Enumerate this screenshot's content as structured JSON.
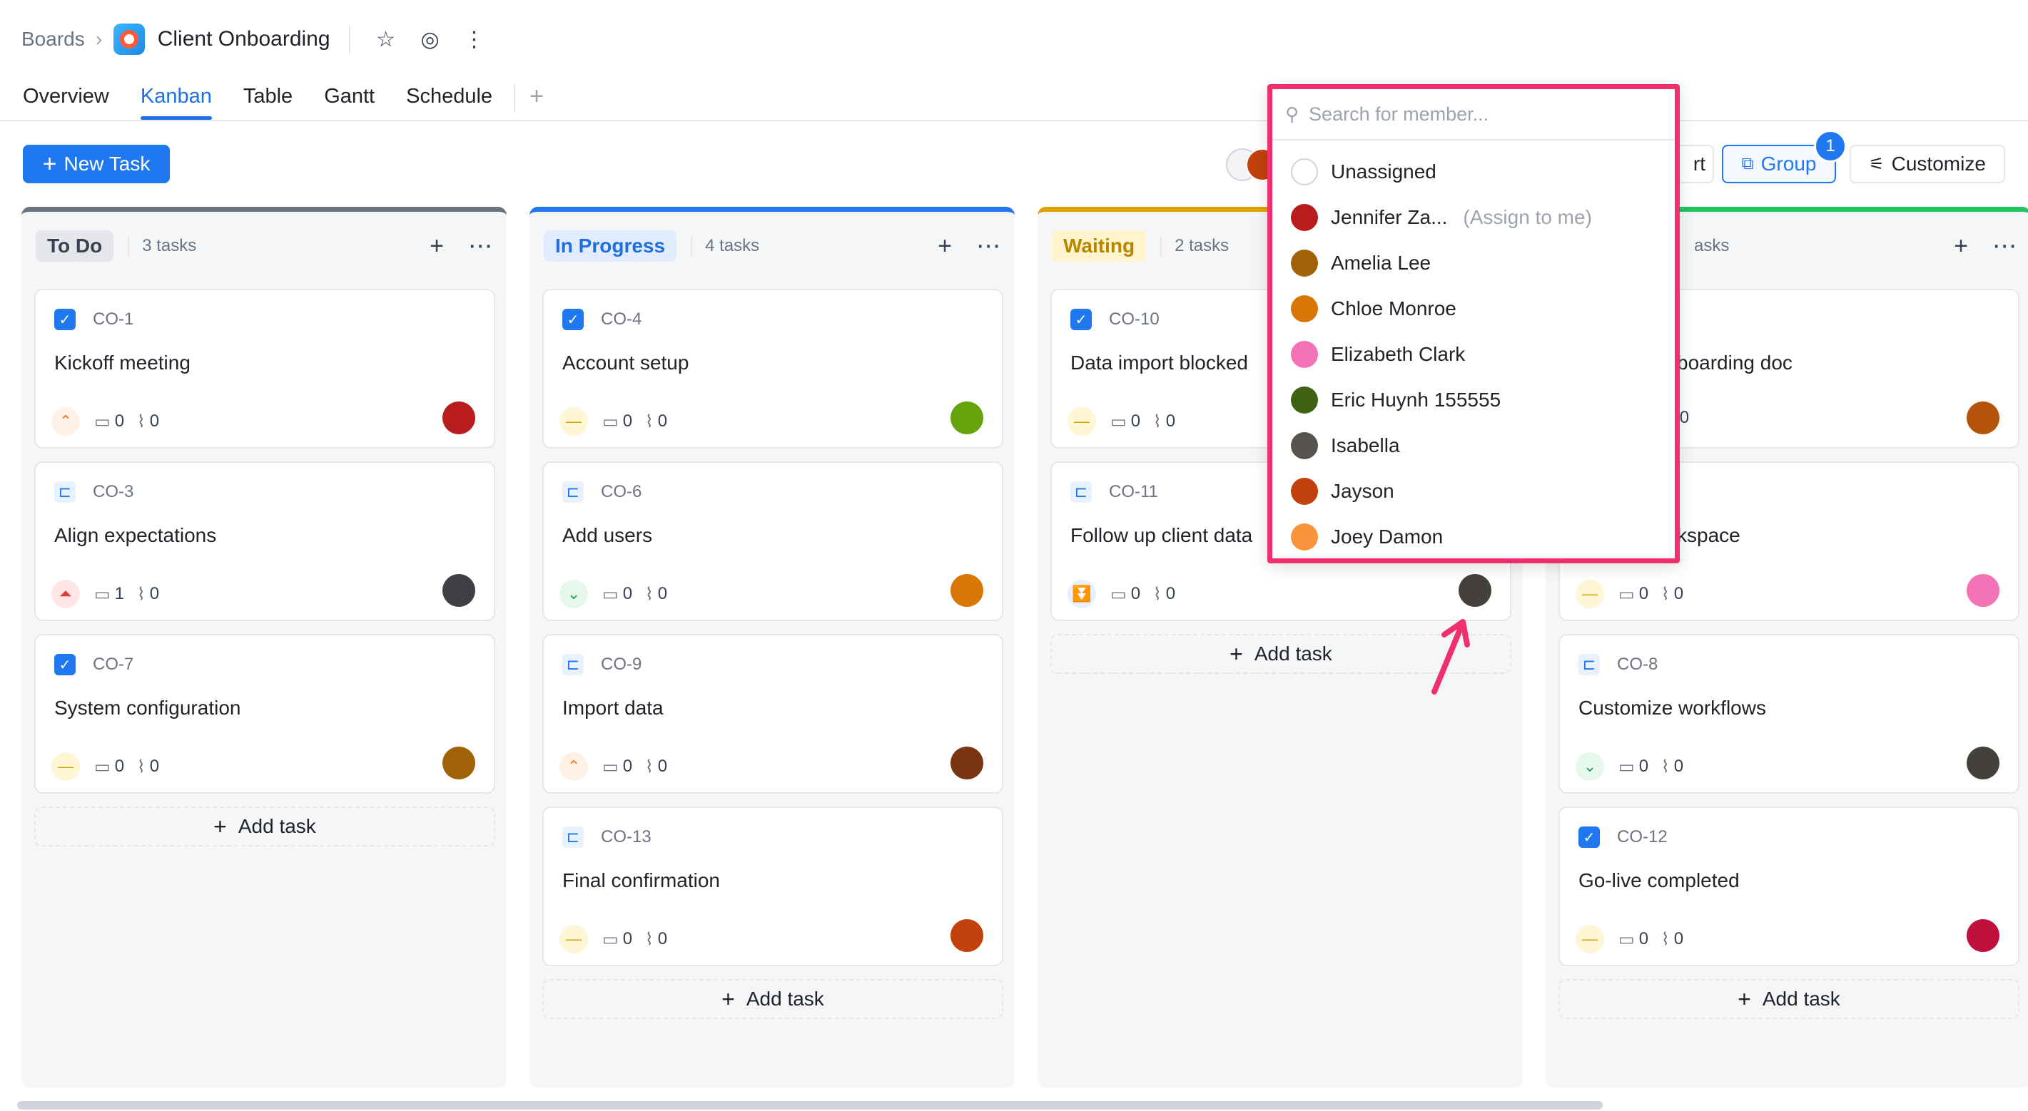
{
  "breadcrumb": {
    "root": "Boards",
    "separator": "›",
    "board": "Client Onboarding"
  },
  "tabs": [
    {
      "label": "Overview",
      "active": false
    },
    {
      "label": "Kanban",
      "active": true
    },
    {
      "label": "Table",
      "active": false
    },
    {
      "label": "Gantt",
      "active": false
    },
    {
      "label": "Schedule",
      "active": false
    }
  ],
  "toolbar": {
    "new_task": "New Task",
    "sort_partial": "rt",
    "group": "Group",
    "group_badge": "1",
    "customize": "Customize"
  },
  "columns": [
    {
      "name": "To Do",
      "count": "3 tasks",
      "accent": "#6b7280",
      "pill_bg": "#e5e7eb",
      "pill_fg": "#374151",
      "cards": [
        {
          "key": "CO-1",
          "title": "Kickoff meeting",
          "type": "task",
          "priority": "high",
          "comments": "0",
          "attachments": "0",
          "avatar": "#b91c1c"
        },
        {
          "key": "CO-3",
          "title": "Align expectations",
          "type": "subtask",
          "priority": "urgent",
          "comments": "1",
          "attachments": "0",
          "avatar": "#3f3f46"
        },
        {
          "key": "CO-7",
          "title": "System configuration",
          "type": "task",
          "priority": "medium",
          "comments": "0",
          "attachments": "0",
          "avatar": "#a16207"
        }
      ],
      "add_task": "Add task"
    },
    {
      "name": "In Progress",
      "count": "4 tasks",
      "accent": "#1f78f0",
      "pill_bg": "#e1ecff",
      "pill_fg": "#1f6fe0",
      "cards": [
        {
          "key": "CO-4",
          "title": "Account setup",
          "type": "task",
          "priority": "medium",
          "comments": "0",
          "attachments": "0",
          "avatar": "#65a30d"
        },
        {
          "key": "CO-6",
          "title": "Add users",
          "type": "subtask",
          "priority": "low",
          "comments": "0",
          "attachments": "0",
          "avatar": "#d97706"
        },
        {
          "key": "CO-9",
          "title": "Import data",
          "type": "subtask",
          "priority": "high",
          "comments": "0",
          "attachments": "0",
          "avatar": "#78350f"
        },
        {
          "key": "CO-13",
          "title": "Final confirmation",
          "type": "subtask",
          "priority": "medium",
          "comments": "0",
          "attachments": "0",
          "avatar": "#c2410c"
        }
      ],
      "add_task": "Add task"
    },
    {
      "name": "Waiting",
      "count": "2 tasks",
      "accent": "#e0a300",
      "pill_bg": "#fff4cc",
      "pill_fg": "#b78600",
      "cards": [
        {
          "key": "CO-10",
          "title": "Data import blocked",
          "type": "task",
          "priority": "medium",
          "comments": "0",
          "attachments": "0",
          "avatar": "#57534e"
        },
        {
          "key": "CO-11",
          "title": "Follow up client data",
          "type": "subtask",
          "priority": "lowest",
          "comments": "0",
          "attachments": "0",
          "avatar": "#44403c"
        }
      ],
      "add_task": "Add task"
    },
    {
      "name": "",
      "count": "asks",
      "accent": "#22c55e",
      "pill_bg": "#f5f6f8",
      "pill_fg": "#15803d",
      "cards": [
        {
          "key": "",
          "title": "boarding doc",
          "type": "none",
          "priority": "none",
          "comments": "",
          "attachments": "0",
          "avatar": "#b45309"
        },
        {
          "key": "",
          "title": "kspace",
          "type": "none",
          "priority": "medium",
          "comments": "0",
          "attachments": "0",
          "avatar": "#f472b6"
        },
        {
          "key": "CO-8",
          "title": "Customize workflows",
          "type": "subtask",
          "priority": "low",
          "comments": "0",
          "attachments": "0",
          "avatar": "#44403c"
        },
        {
          "key": "CO-12",
          "title": "Go-live completed",
          "type": "task",
          "priority": "medium",
          "comments": "0",
          "attachments": "0",
          "avatar": "#be123c"
        }
      ],
      "add_task": "Add task"
    }
  ],
  "member_dropdown": {
    "placeholder": "Search for member...",
    "members": [
      {
        "name": "Unassigned",
        "assign_hint": "",
        "avatar": "none"
      },
      {
        "name": "Jennifer Za...",
        "assign_hint": "(Assign to me)",
        "avatar": "#b91c1c"
      },
      {
        "name": "Amelia Lee",
        "assign_hint": "",
        "avatar": "#a16207"
      },
      {
        "name": "Chloe Monroe",
        "assign_hint": "",
        "avatar": "#d97706"
      },
      {
        "name": "Elizabeth Clark",
        "assign_hint": "",
        "avatar": "#f472b6"
      },
      {
        "name": "Eric Huynh 155555",
        "assign_hint": "",
        "avatar": "#3f6212"
      },
      {
        "name": "Isabella",
        "assign_hint": "",
        "avatar": "#57534e"
      },
      {
        "name": "Jayson",
        "assign_hint": "",
        "avatar": "#c2410c"
      },
      {
        "name": "Joey Damon",
        "assign_hint": "",
        "avatar": "#fb923c"
      }
    ]
  },
  "colors": {
    "primary": "#1f78f0",
    "highlight": "#f0306c"
  }
}
